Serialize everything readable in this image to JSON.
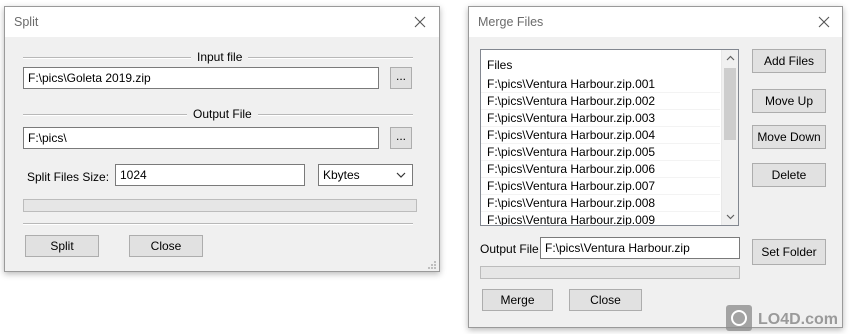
{
  "split": {
    "title": "Split",
    "input_group_label": "Input file",
    "input_file": "F:\\pics\\Goleta 2019.zip",
    "browse_label": "...",
    "output_group_label": "Output File",
    "output_file": "F:\\pics\\",
    "size_label": "Split Files Size:",
    "size_value": "1024",
    "unit_value": "Kbytes",
    "progress": 0,
    "split_button": "Split",
    "close_button": "Close"
  },
  "merge": {
    "title": "Merge Files",
    "list_header": "Files",
    "files": [
      "F:\\pics\\Ventura Harbour.zip.001",
      "F:\\pics\\Ventura Harbour.zip.002",
      "F:\\pics\\Ventura Harbour.zip.003",
      "F:\\pics\\Ventura Harbour.zip.004",
      "F:\\pics\\Ventura Harbour.zip.005",
      "F:\\pics\\Ventura Harbour.zip.006",
      "F:\\pics\\Ventura Harbour.zip.007",
      "F:\\pics\\Ventura Harbour.zip.008",
      "F:\\pics\\Ventura Harbour.zip.009"
    ],
    "add_files_button": "Add Files",
    "move_up_button": "Move Up",
    "move_down_button": "Move Down",
    "delete_button": "Delete",
    "output_label": "Output File",
    "output_file": "F:\\pics\\Ventura Harbour.zip",
    "set_folder_button": "Set Folder",
    "progress": 0,
    "merge_button": "Merge",
    "close_button": "Close"
  },
  "watermark": {
    "text": "LO4D.com"
  },
  "colors": {
    "progress_fill": "#06b025",
    "window_bg": "#f0f0f0"
  }
}
